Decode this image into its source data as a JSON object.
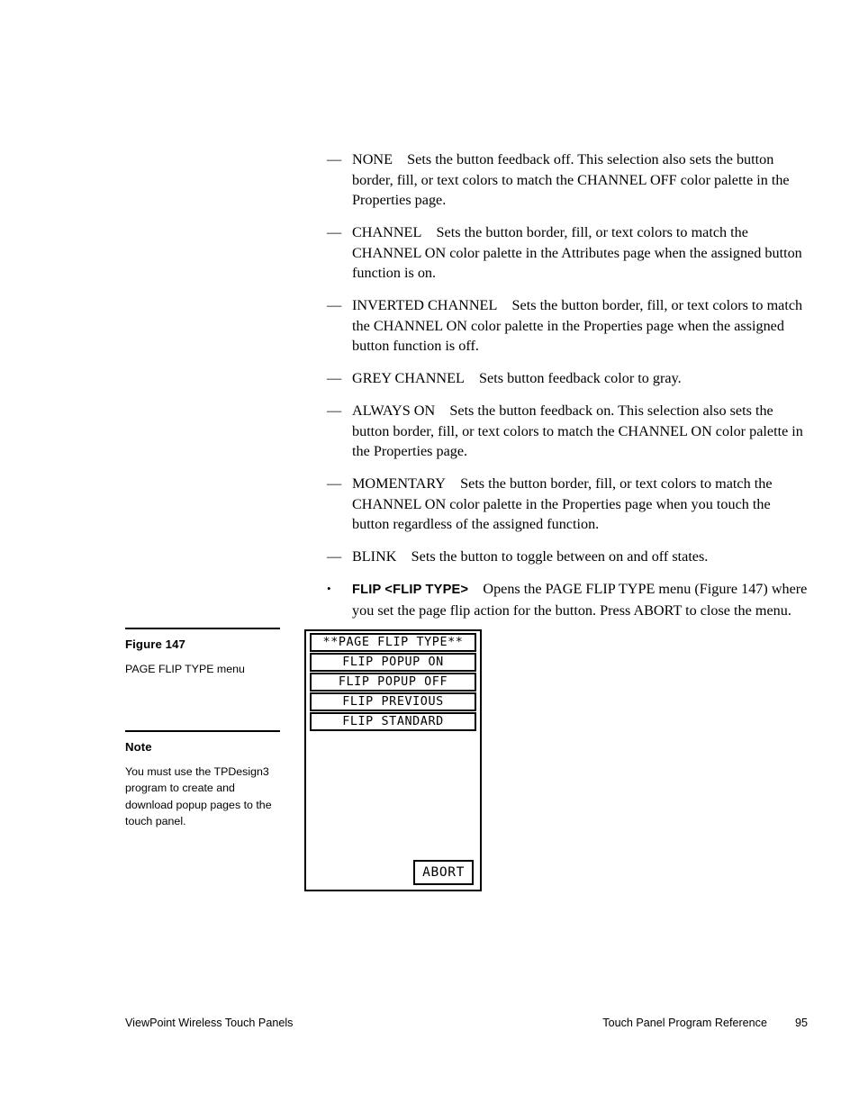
{
  "body": {
    "items": [
      {
        "marker": "—",
        "marker_type": "dash",
        "term": "NONE",
        "term_style": "serif",
        "text": "Sets the button feedback off. This selection also sets the button border, fill, or text colors to match the CHANNEL OFF color palette in the Properties page."
      },
      {
        "marker": "—",
        "marker_type": "dash",
        "term": "CHANNEL",
        "term_style": "serif",
        "text": "Sets the button border, fill, or text colors to match the CHANNEL ON color palette in the Attributes page when the assigned button function is on."
      },
      {
        "marker": "—",
        "marker_type": "dash",
        "term": "INVERTED CHANNEL",
        "term_style": "serif",
        "text": "Sets the button border, fill, or text colors to match the CHANNEL ON color palette in the Properties page when the assigned button function is off."
      },
      {
        "marker": "—",
        "marker_type": "dash",
        "term": "GREY CHANNEL",
        "term_style": "serif",
        "text": "Sets button feedback color to gray."
      },
      {
        "marker": "—",
        "marker_type": "dash",
        "term": "ALWAYS ON",
        "term_style": "serif",
        "text": "Sets the button feedback on. This selection also sets the button border, fill, or text colors to match the CHANNEL ON color palette in the Properties page."
      },
      {
        "marker": "—",
        "marker_type": "dash",
        "term": "MOMENTARY",
        "term_style": "serif",
        "text": "Sets the button border, fill, or text colors to match the CHANNEL ON color palette in the Properties page when you touch the button regardless of the assigned function."
      },
      {
        "marker": "—",
        "marker_type": "dash",
        "term": "BLINK",
        "term_style": "serif",
        "text": "Sets the button to toggle between on and off states."
      },
      {
        "marker": "•",
        "marker_type": "bullet",
        "term": "FLIP <FLIP TYPE>",
        "term_style": "bold-sans",
        "text": "Opens the PAGE FLIP TYPE menu (Figure 147) where you set the page flip action for the button. Press ABORT to close the menu."
      }
    ]
  },
  "margin": {
    "figure_label": "Figure 147",
    "figure_caption": "PAGE FLIP TYPE menu",
    "note_label": "Note",
    "note_text": "You must use the TPDesign3 program to create and download popup pages to the touch panel."
  },
  "figure": {
    "menu_title": "**PAGE FLIP TYPE**",
    "menu_items": [
      "FLIP POPUP ON",
      "FLIP POPUP OFF",
      "FLIP PREVIOUS",
      "FLIP STANDARD"
    ],
    "abort_label": "ABORT"
  },
  "footer": {
    "left": "ViewPoint Wireless Touch Panels",
    "middle": "Touch Panel Program Reference",
    "page_number": "95"
  },
  "colors": {
    "text": "#000000",
    "background": "#ffffff",
    "rule": "#000000"
  }
}
